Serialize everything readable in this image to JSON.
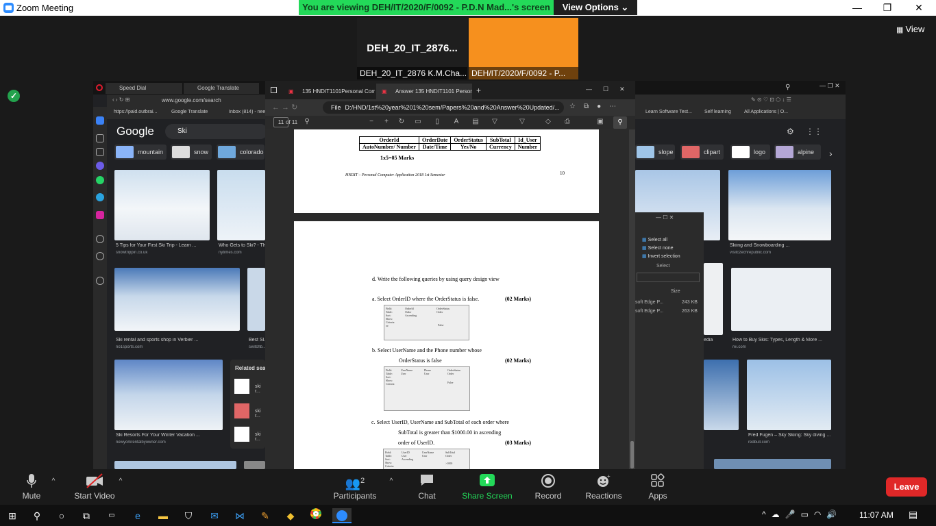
{
  "titlebar": {
    "title": "Zoom Meeting",
    "minimize": "—",
    "maximize": "❐",
    "close": "✕"
  },
  "banner": {
    "viewing": "You are viewing DEH/IT/2020/F/0092 - P.D.N Mad...'s screen",
    "view_options": "View Options ⌄"
  },
  "tiles": [
    {
      "name": "DEH_20_IT_2876...",
      "caption": "DEH_20_IT_2876 K.M.Cha..."
    },
    {
      "caption": "DEH/IT/2020/F/0092 - P..."
    }
  ],
  "view_button": "View",
  "opera": {
    "tabs": [
      "Speed Dial",
      "Google Translate"
    ],
    "url": "www.google.com/search",
    "bookmarks": [
      "https://paid.outbrai...",
      "Google Translate",
      "Inbox (814) - nee..."
    ],
    "bookmarks_right": [
      "Learn Software Test...",
      "Self learning",
      "All Applications | O..."
    ],
    "google": {
      "logo": "Google",
      "query": "Ski",
      "chips": [
        "mountain",
        "snow",
        "colorado"
      ],
      "chips_right": [
        "slope",
        "clipart",
        "logo",
        "alpine"
      ]
    },
    "results_left": [
      {
        "caption": "5 Tips for Your First Ski Trip - Learn ...",
        "source": "snowtrippin.co.uk"
      },
      {
        "caption": "Who Gets to Ski? - Th...",
        "source": "nytimes.com"
      },
      {
        "caption": "Ski rental and sports shop in Verbier ...",
        "source": "no1sports.com"
      },
      {
        "caption": "Best Sl...",
        "source": "switchb..."
      },
      {
        "caption": "Ski Resorts For Your Winter Vacation ...",
        "source": "newyorkrentalbyowner.com"
      }
    ],
    "related": {
      "title": "Related sea...",
      "items": [
        "ski r...",
        "ski r...",
        "ski r..."
      ]
    },
    "results_right": [
      {
        "caption": "Skiing and Snowboarding ...",
        "source": "visitczechrepublic.com"
      },
      {
        "caption": "edia",
        "source": ""
      },
      {
        "caption": "How to Buy Skis: Types, Length & More ...",
        "source": "rei.com"
      },
      {
        "caption": "Fred Fugen – Sky Skiing: Sky diving ...",
        "source": "redbull.com"
      }
    ]
  },
  "pdf": {
    "tabs": [
      "135 HNDIT1101Personal Compu...",
      "Answer 135 HNDIT1101 Persona..."
    ],
    "file_label": "File",
    "url": "D:/HND/1st%20year%201%20sem/Papers%20and%20Answer%20Updated/...",
    "page": "11",
    "of": "of 11",
    "table": {
      "headers": [
        "OrderId",
        "OrderDate",
        "OrderStatus",
        "SubTotal",
        "Id_User"
      ],
      "types": [
        "AutoNumber/ Number",
        "Date/Time",
        "Yes/No",
        "Currency",
        "Number"
      ]
    },
    "marks": "1x5=05 Marks",
    "footer": "HNDIT – Personal Computer Application 2018 1st Semester",
    "page_number": "10",
    "q_intro": "d.   Write the following queries by using query design view",
    "qa": "a.   Select OrderID  where the OrderStatus is false.",
    "qa_marks": "(02 Marks)",
    "qb1": "b.   Select UserName and the Phone number whose",
    "qb2": "OrderStatus is false",
    "qb_marks": "(02 Marks)",
    "qc1": "c.   Select UserID, UserName and SubTotal of each order where",
    "qc2": "SubTotal is greater than $1000.00 in ascending",
    "qc3": "order of UserID.",
    "qc_marks": "(03 Marks)"
  },
  "explorer": {
    "items": [
      "Select all",
      "Select none",
      "Invert selection"
    ],
    "group": "Select",
    "size_header": "Size",
    "files": [
      {
        "name": "soft Edge P...",
        "size": "243 KB"
      },
      {
        "name": "soft Edge P...",
        "size": "263 KB"
      }
    ]
  },
  "toolbar": {
    "mute": "Mute",
    "video": "Start Video",
    "participants": "Participants",
    "participant_count": "2",
    "chat": "Chat",
    "share": "Share Screen",
    "record": "Record",
    "reactions": "Reactions",
    "apps": "Apps",
    "leave": "Leave"
  },
  "taskbar": {
    "time": "11:07 AM"
  },
  "colors": {
    "share_green": "#23d959",
    "leave_red": "#e02828",
    "zoom_blue": "#2d8cff",
    "tile_orange": "#f6901e"
  }
}
